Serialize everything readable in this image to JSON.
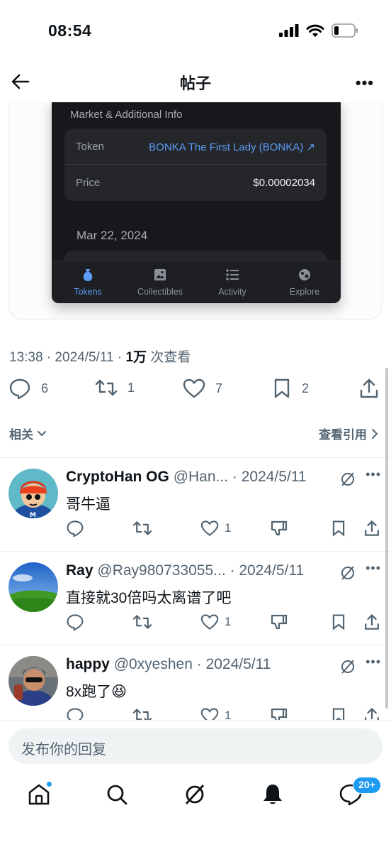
{
  "status": {
    "time": "08:54"
  },
  "nav": {
    "title": "帖子",
    "more": "•••"
  },
  "wallet": {
    "section_title": "Market & Additional Info",
    "rows": [
      {
        "label": "Token",
        "value": "BONKA The First Lady (BONKA) ↗"
      },
      {
        "label": "Price",
        "value": "$0.00002034"
      }
    ],
    "date": "Mar 22, 2024",
    "tabs": [
      "Tokens",
      "Collectibles",
      "Activity",
      "Explore"
    ],
    "accent": "#5b9cf5"
  },
  "tweet_meta": {
    "time": "13:38 · 2024/5/11 · ",
    "views": "1万",
    "views_suffix": " 次查看"
  },
  "tweet_actions": {
    "replies": "6",
    "retweets": "1",
    "likes": "7",
    "bookmarks": "2"
  },
  "related": {
    "left": "相关",
    "right": "查看引用"
  },
  "replies": [
    {
      "name": "CryptoHan OG",
      "handle": "@Han...",
      "date": "2024/5/11",
      "text": "哥牛逼",
      "likes": "1"
    },
    {
      "name": "Ray",
      "handle": "@Ray980733055...",
      "date": "2024/5/11",
      "text": "直接就30倍吗太离谱了吧",
      "likes": "1"
    },
    {
      "name": "happy",
      "handle": "@0xyeshen",
      "date": "2024/5/11",
      "text": "8x跑了😆",
      "likes": "1"
    }
  ],
  "compose": {
    "placeholder": "发布你的回复"
  },
  "tabbar": {
    "messages_badge": "20+",
    "accent": "#1d9bf0"
  }
}
